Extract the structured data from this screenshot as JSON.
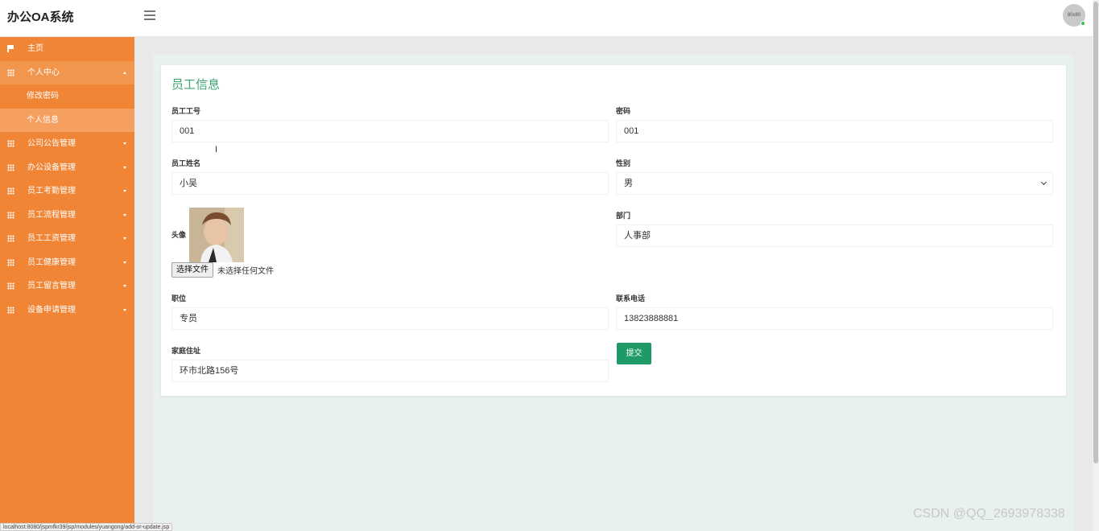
{
  "app": {
    "title": "办公OA系统",
    "avatar_text": "80x80"
  },
  "sidebar": {
    "items": [
      {
        "label": "主页",
        "icon": "flag-icon"
      },
      {
        "label": "个人中心",
        "icon": "grid-icon",
        "expanded": true
      },
      {
        "label": "修改密码",
        "sub": true
      },
      {
        "label": "个人信息",
        "sub": true,
        "selected": true
      },
      {
        "label": "公司公告管理",
        "icon": "grid-icon"
      },
      {
        "label": "办公设备管理",
        "icon": "grid-icon"
      },
      {
        "label": "员工考勤管理",
        "icon": "grid-icon"
      },
      {
        "label": "员工流程管理",
        "icon": "grid-icon"
      },
      {
        "label": "员工工资管理",
        "icon": "grid-icon"
      },
      {
        "label": "员工健康管理",
        "icon": "grid-icon"
      },
      {
        "label": "员工留言管理",
        "icon": "grid-icon"
      },
      {
        "label": "设备申请管理",
        "icon": "grid-icon"
      }
    ]
  },
  "form": {
    "title": "员工信息",
    "employee_id": {
      "label": "员工工号",
      "value": "001"
    },
    "password": {
      "label": "密码",
      "value": "001"
    },
    "name": {
      "label": "员工姓名",
      "value": "小吴"
    },
    "gender": {
      "label": "性别",
      "value": "男"
    },
    "avatar": {
      "label": "头像",
      "button": "选择文件",
      "status": "未选择任何文件"
    },
    "department": {
      "label": "部门",
      "value": "人事部"
    },
    "position": {
      "label": "职位",
      "value": "专员"
    },
    "phone": {
      "label": "联系电话",
      "value": "13823888881"
    },
    "address": {
      "label": "家庭住址",
      "value": "环市北路156号"
    },
    "submit": "提交"
  },
  "status_url": "localhost:8080/jspmfkr39/jsp/modules/yuangong/add-or-update.jsp",
  "watermark": "CSDN @QQ_2693978338",
  "colors": {
    "sidebar": "#ef8535",
    "accent": "#3aa46e",
    "submit": "#1e9a66"
  }
}
